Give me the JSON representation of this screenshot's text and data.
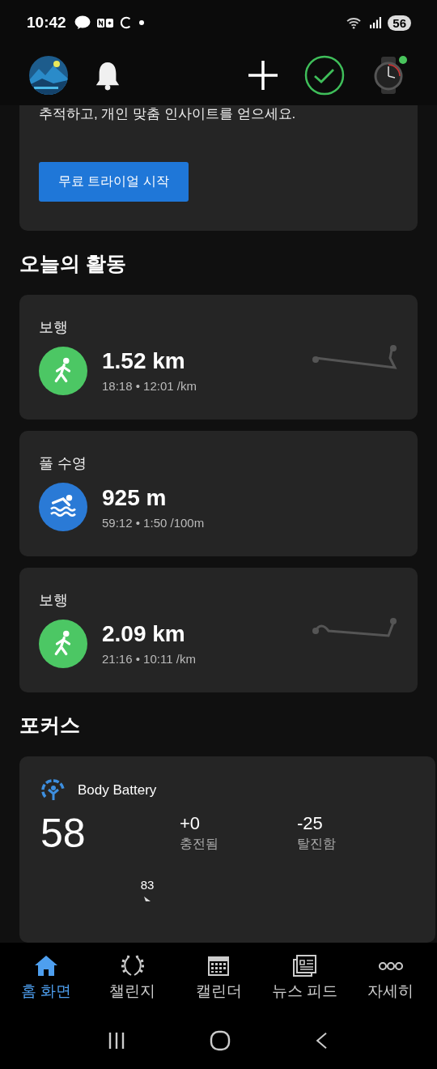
{
  "status_bar": {
    "time": "10:42",
    "battery": "56"
  },
  "promo": {
    "text": "추적하고, 개인 맞춤 인사이트를 얻으세요.",
    "button": "무료 트라이얼 시작"
  },
  "activities_title": "오늘의 활동",
  "activities": [
    {
      "kind": "walk",
      "name": "보행",
      "value": "1.52 km",
      "detail": "18:18 • 12:01 /km",
      "route": {
        "kind": "straight"
      }
    },
    {
      "kind": "swim",
      "name": "풀 수영",
      "value": "925 m",
      "detail": "59:12 • 1:50 /100m"
    },
    {
      "kind": "walk",
      "name": "보행",
      "value": "2.09 km",
      "detail": "21:16 • 10:11 /km",
      "route": {
        "kind": "loop"
      }
    }
  ],
  "focus_title": "포커스",
  "body_battery": {
    "title": "Body Battery",
    "value": "58",
    "stats": [
      {
        "value": "+0",
        "label": "충전됨"
      },
      {
        "value": "-25",
        "label": "탈진함"
      }
    ],
    "peak_label": "83"
  },
  "tabs": [
    {
      "kind": "home",
      "label": "홈 화면",
      "selected": true
    },
    {
      "kind": "laurel",
      "label": "챌린지",
      "selected": false
    },
    {
      "kind": "calendar",
      "label": "캘린더",
      "selected": false
    },
    {
      "kind": "news",
      "label": "뉴스 피드",
      "selected": false
    },
    {
      "kind": "more",
      "label": "자세히",
      "selected": false
    }
  ]
}
